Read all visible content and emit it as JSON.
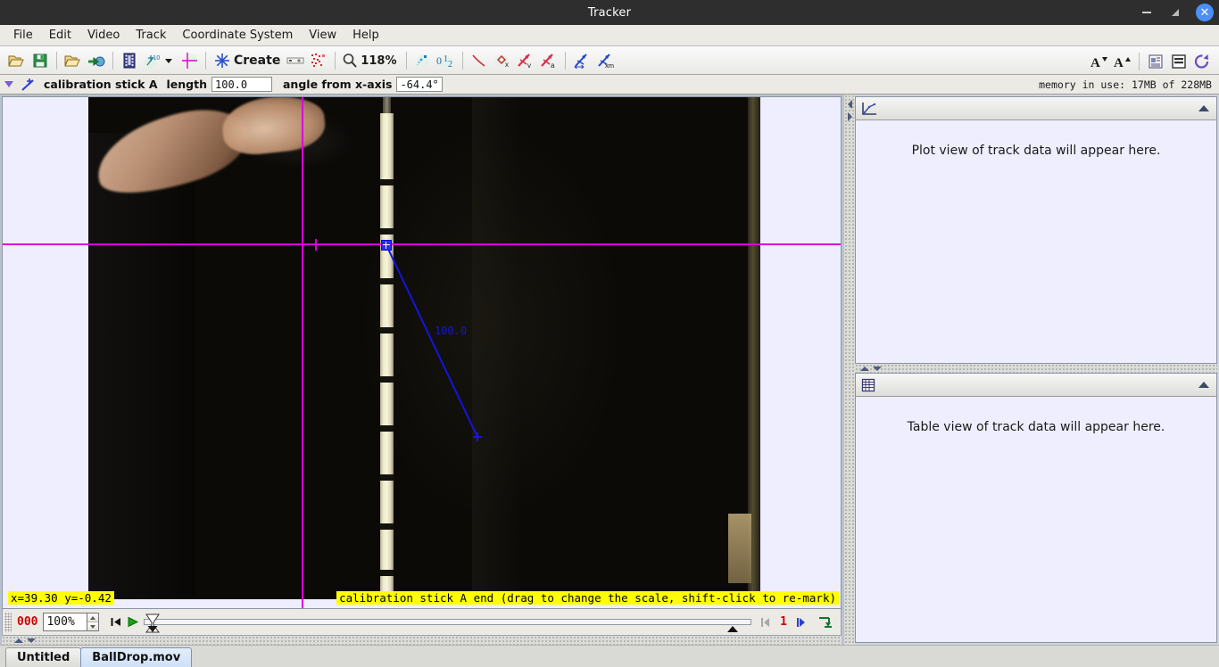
{
  "window": {
    "title": "Tracker",
    "minimize_label": "minimize",
    "maximize_label": "maximize",
    "close_label": "close"
  },
  "menubar": {
    "items": [
      {
        "label": "File"
      },
      {
        "label": "Edit"
      },
      {
        "label": "Video"
      },
      {
        "label": "Track"
      },
      {
        "label": "Coordinate System"
      },
      {
        "label": "View"
      },
      {
        "label": "Help"
      }
    ]
  },
  "toolbar": {
    "open_label": "open-folder-icon",
    "save_label": "save-disk-icon",
    "open_library_label": "open-library-icon",
    "export_label": "export-to-web-icon",
    "clip_label": "video-filmstrip-icon",
    "track_control_label": "track-control-icon",
    "axes_label": "axes-icon",
    "create_label": "Create",
    "tape_label": "tape-measure-icon",
    "calibration_label": "calibration-points-icon",
    "zoom_label": "118%",
    "zoom_icon": "magnifier-icon",
    "path_label": "trails-icon",
    "labels_label": "01-2-labels-icon",
    "position_label": "position-vector-icon",
    "xcomponent_label": "x-component-icon",
    "velocity_label": "velocity-vector-icon",
    "accel_label": "acceleration-vector-icon",
    "stretch_label": "stretch-vectors-icon",
    "scale_label": "scale-vectors-icon",
    "font_smaller_label": "font-smaller-icon",
    "font_larger_label": "font-larger-icon",
    "notes_label": "notes-icon",
    "datatool_label": "data-tool-icon",
    "refresh_label": "refresh-icon"
  },
  "trackbar": {
    "expand_label": "expand-triangle-icon",
    "track_icon": "calibration-stick-icon",
    "track_name": "calibration stick A",
    "length_label": "length",
    "length_value": "100.0",
    "angle_label": "angle from x-axis",
    "angle_value": "-64.4°",
    "memory": "memory in use: 17MB of 228MB"
  },
  "video": {
    "calibration_length_label": "100.0",
    "status_left": "x=39.30  y=-0.42",
    "status_right": "calibration stick A end (drag to change the scale, shift-click to re-mark)",
    "axis_color": "#d900d9",
    "stick_color": "#1515e0",
    "status_bg": "#ffff00"
  },
  "player": {
    "frame_number": "000",
    "rate_value": "100%",
    "rate_stepper_up": "increase-rate",
    "rate_stepper_down": "decrease-rate",
    "goto_start_label": "go-to-start-icon",
    "play_label": "play-icon",
    "slider_thumb_label": "playhead-thumb",
    "step_back_label": "step-back-icon",
    "step_size": "1",
    "step_forward_label": "step-forward-icon",
    "clip_settings_label": "clip-settings-icon"
  },
  "panels": {
    "plot": {
      "icon": "plot-icon",
      "message": "Plot view of track data will appear here.",
      "collapse_label": "collapse-plot-panel"
    },
    "table": {
      "icon": "table-icon",
      "message": "Table view of track data will appear here.",
      "collapse_label": "collapse-table-panel"
    }
  },
  "tabs": [
    {
      "label": "Untitled",
      "active": false
    },
    {
      "label": "BallDrop.mov",
      "active": true
    }
  ]
}
